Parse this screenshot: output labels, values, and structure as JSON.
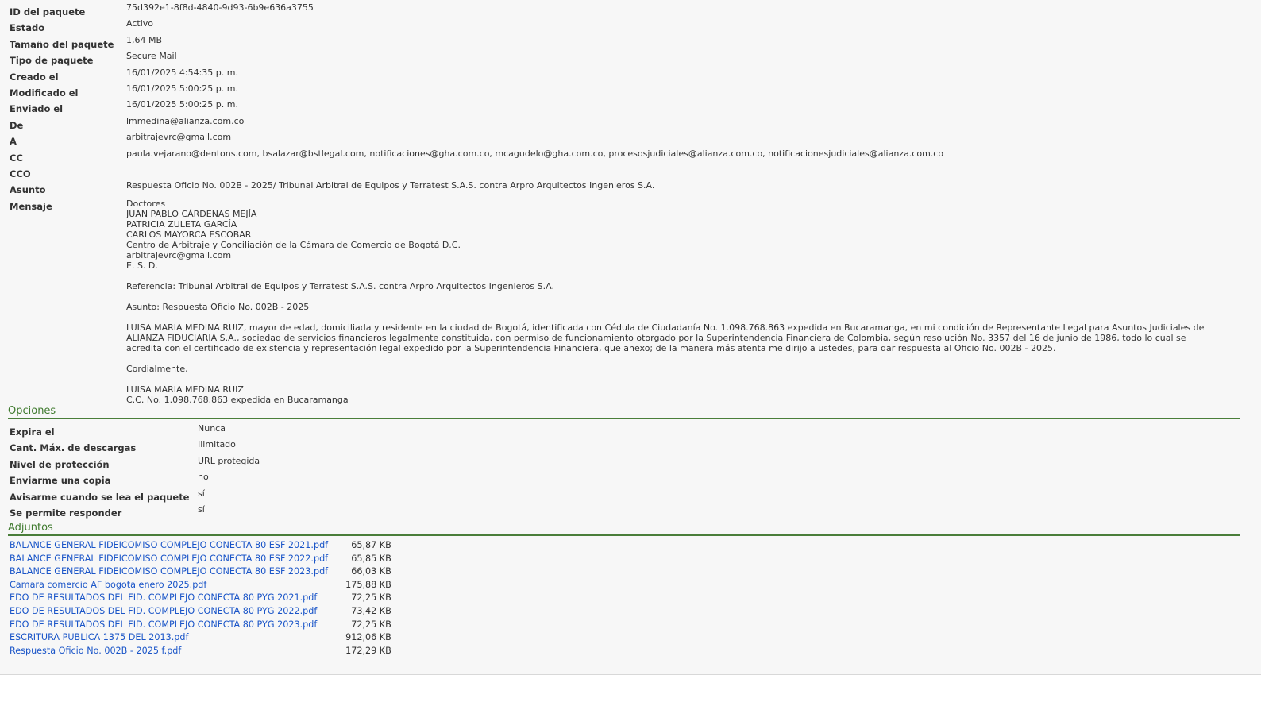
{
  "details": [
    {
      "label": "ID del paquete",
      "value": "75d392e1-8f8d-4840-9d93-6b9e636a3755"
    },
    {
      "label": "Estado",
      "value": "Activo"
    },
    {
      "label": "Tamaño del paquete",
      "value": "1,64 MB"
    },
    {
      "label": "Tipo de paquete",
      "value": "Secure Mail"
    },
    {
      "label": "Creado el",
      "value": "16/01/2025 4:54:35 p. m."
    },
    {
      "label": "Modificado el",
      "value": "16/01/2025 5:00:25 p. m."
    },
    {
      "label": "Enviado el",
      "value": "16/01/2025 5:00:25 p. m."
    },
    {
      "label": "De",
      "value": "lmmedina@alianza.com.co"
    },
    {
      "label": "A",
      "value": "arbitrajevrc@gmail.com"
    },
    {
      "label": "CC",
      "value": "paula.vejarano@dentons.com, bsalazar@bstlegal.com, notificaciones@gha.com.co, mcagudelo@gha.com.co, procesosjudiciales@alianza.com.co, notificacionesjudiciales@alianza.com.co"
    },
    {
      "label": "CCO",
      "value": ""
    },
    {
      "label": "Asunto",
      "value": "Respuesta Oficio No. 002B - 2025/ Tribunal Arbitral de Equipos y Terratest S.A.S. contra Arpro Arquitectos Ingenieros S.A."
    }
  ],
  "message": {
    "label": "Mensaje",
    "paragraphs": [
      [
        "Doctores",
        "JUAN PABLO CÁRDENAS MEJÍA",
        "PATRICIA ZULETA GARCÍA",
        "CARLOS MAYORCA ESCOBAR",
        "Centro de Arbitraje y Conciliación de la Cámara de Comercio de Bogotá D.C.",
        "arbitrajevrc@gmail.com",
        "E. S. D."
      ],
      [
        "Referencia: Tribunal Arbitral de Equipos y Terratest S.A.S. contra Arpro Arquitectos Ingenieros S.A."
      ],
      [
        "Asunto: Respuesta Oficio No. 002B - 2025"
      ],
      [
        "LUISA MARIA MEDINA RUIZ, mayor de edad, domiciliada y residente en la ciudad de Bogotá, identificada con Cédula de Ciudadanía No. 1.098.768.863 expedida en Bucaramanga, en mi condición de Representante Legal para Asuntos Judiciales de",
        "ALIANZA FIDUCIARIA S.A., sociedad de servicios financieros legalmente constituida, con permiso de funcionamiento otorgado por la Superintendencia Financiera de Colombia, según resolución No. 3357 del 16 de junio de 1986, todo lo cual se",
        "acredita con el certificado de existencia y representación legal expedido por la Superintendencia Financiera, que anexo; de la manera más atenta me dirijo a ustedes, para dar respuesta al Oficio No. 002B - 2025."
      ],
      [
        "Cordialmente,"
      ],
      [
        "LUISA MARIA MEDINA RUIZ",
        "C.C. No. 1.098.768.863 expedida en Bucaramanga"
      ]
    ]
  },
  "options": {
    "title": "Opciones",
    "rows": [
      {
        "label": "Expira el",
        "value": "Nunca"
      },
      {
        "label": "Cant. Máx. de descargas",
        "value": "Ilimitado"
      },
      {
        "label": "Nivel de protección",
        "value": "URL protegida"
      },
      {
        "label": "Enviarme una copia",
        "value": "no"
      },
      {
        "label": "Avisarme cuando se lea el paquete",
        "value": "sí"
      },
      {
        "label": "Se permite responder",
        "value": "sí"
      }
    ]
  },
  "attachments": {
    "title": "Adjuntos",
    "files": [
      {
        "name": "BALANCE GENERAL FIDEICOMISO COMPLEJO CONECTA 80 ESF 2021.pdf",
        "size": "65,87 KB"
      },
      {
        "name": "BALANCE GENERAL FIDEICOMISO COMPLEJO CONECTA 80 ESF 2022.pdf",
        "size": "65,85 KB"
      },
      {
        "name": "BALANCE GENERAL FIDEICOMISO COMPLEJO CONECTA 80 ESF 2023.pdf",
        "size": "66,03 KB"
      },
      {
        "name": "Camara comercio AF bogota enero 2025.pdf",
        "size": "175,88 KB"
      },
      {
        "name": "EDO DE RESULTADOS DEL FID. COMPLEJO CONECTA 80 PYG 2021.pdf",
        "size": "72,25 KB"
      },
      {
        "name": "EDO DE RESULTADOS DEL FID. COMPLEJO CONECTA 80 PYG 2022.pdf",
        "size": "73,42 KB"
      },
      {
        "name": "EDO DE RESULTADOS DEL FID. COMPLEJO CONECTA 80 PYG 2023.pdf",
        "size": "72,25 KB"
      },
      {
        "name": "ESCRITURA PUBLICA 1375 DEL 2013.pdf",
        "size": "912,06 KB"
      },
      {
        "name": "Respuesta Oficio No. 002B - 2025 f.pdf",
        "size": "172,29 KB"
      }
    ]
  }
}
